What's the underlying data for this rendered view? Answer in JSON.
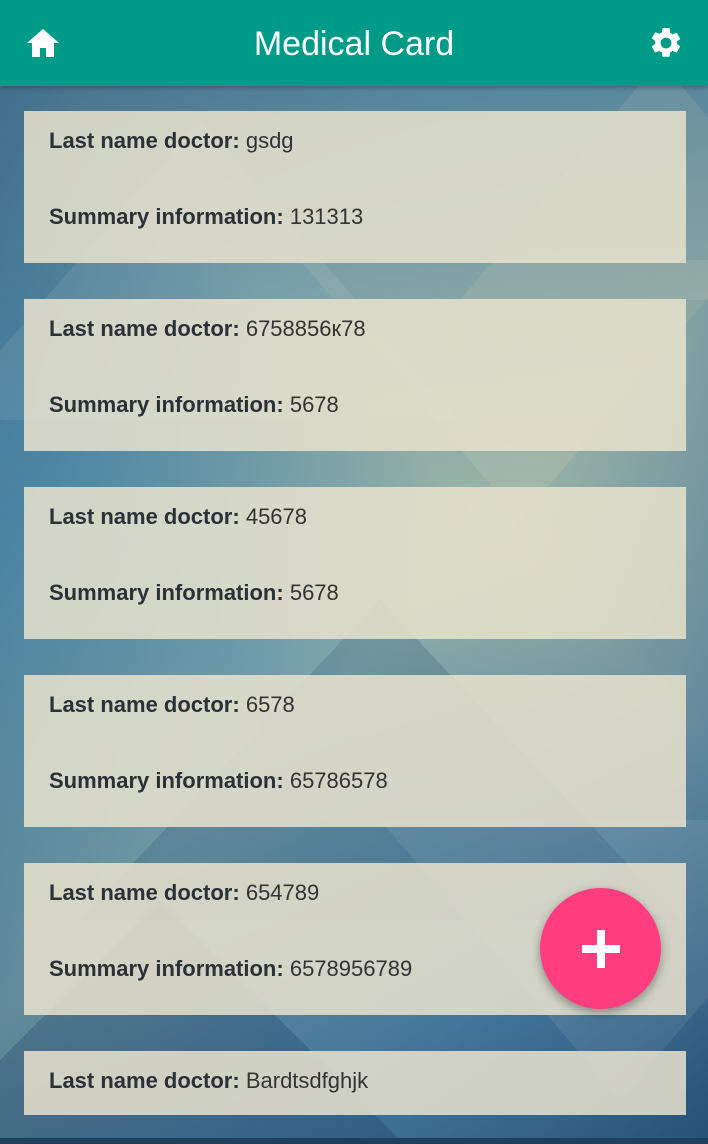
{
  "app_bar": {
    "title": "Medical Card",
    "home_icon": "home-icon",
    "settings_icon": "gear-icon",
    "color": "#009a88"
  },
  "records": [
    {
      "doctor_label": "Last name doctor:",
      "doctor_value": "gsdg",
      "summary_label": "Summary information:",
      "summary_value": "131313"
    },
    {
      "doctor_label": "Last name doctor:",
      "doctor_value": "6758856к78",
      "summary_label": "Summary information:",
      "summary_value": "5678"
    },
    {
      "doctor_label": "Last name doctor:",
      "doctor_value": "45678",
      "summary_label": "Summary information:",
      "summary_value": "5678"
    },
    {
      "doctor_label": "Last name doctor:",
      "doctor_value": "6578",
      "summary_label": "Summary information:",
      "summary_value": "65786578"
    },
    {
      "doctor_label": "Last name doctor:",
      "doctor_value": "654789",
      "summary_label": "Summary information:",
      "summary_value": "6578956789"
    },
    {
      "doctor_label": "Last name doctor:",
      "doctor_value": "Bardtsdfghjk"
    }
  ],
  "fab": {
    "icon": "plus-icon",
    "color": "#ff3d7f"
  }
}
